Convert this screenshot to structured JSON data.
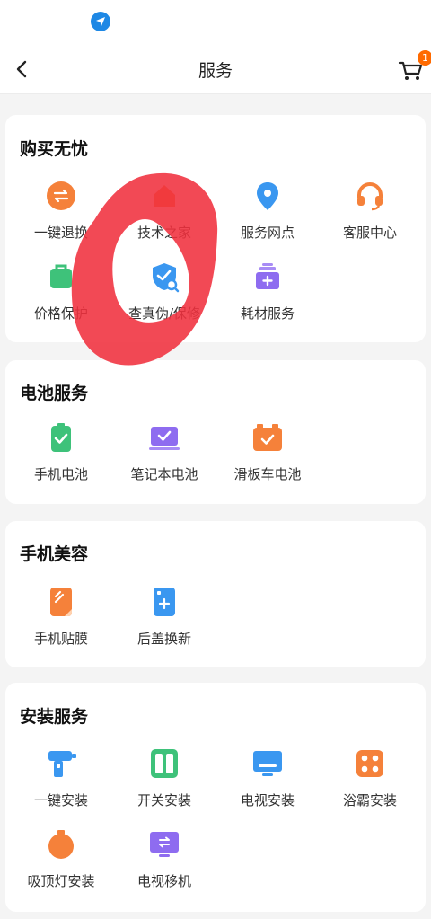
{
  "header": {
    "title": "服务",
    "cart_badge": "1"
  },
  "sections": [
    {
      "title": "购买无忧",
      "items": [
        {
          "label": "一键退换",
          "icon": "exchange-icon",
          "color": "#f5813a"
        },
        {
          "label": "技术之家",
          "icon": "tech-home-icon",
          "color": "#f5813a"
        },
        {
          "label": "服务网点",
          "icon": "location-pin-icon",
          "color": "#3a97f0"
        },
        {
          "label": "客服中心",
          "icon": "headset-icon",
          "color": "#f5813a"
        },
        {
          "label": "价格保护",
          "icon": "price-protect-icon",
          "color": "#3ec27a"
        },
        {
          "label": "查真伪/保修",
          "icon": "shield-search-icon",
          "color": "#3a97f0"
        },
        {
          "label": "耗材服务",
          "icon": "supplies-icon",
          "color": "#8e6cf0"
        }
      ]
    },
    {
      "title": "电池服务",
      "items": [
        {
          "label": "手机电池",
          "icon": "phone-battery-icon",
          "color": "#3ec27a"
        },
        {
          "label": "笔记本电池",
          "icon": "laptop-battery-icon",
          "color": "#8e6cf0"
        },
        {
          "label": "滑板车电池",
          "icon": "scooter-battery-icon",
          "color": "#f5813a"
        }
      ]
    },
    {
      "title": "手机美容",
      "items": [
        {
          "label": "手机贴膜",
          "icon": "screen-film-icon",
          "color": "#f5813a"
        },
        {
          "label": "后盖换新",
          "icon": "back-cover-icon",
          "color": "#3a97f0"
        }
      ]
    },
    {
      "title": "安装服务",
      "items": [
        {
          "label": "一键安装",
          "icon": "drill-icon",
          "color": "#3a97f0"
        },
        {
          "label": "开关安装",
          "icon": "switch-icon",
          "color": "#3ec27a"
        },
        {
          "label": "电视安装",
          "icon": "tv-icon",
          "color": "#3a97f0"
        },
        {
          "label": "浴霸安装",
          "icon": "bath-heater-icon",
          "color": "#f5813a"
        },
        {
          "label": "吸顶灯安装",
          "icon": "ceiling-lamp-icon",
          "color": "#f5813a"
        },
        {
          "label": "电视移机",
          "icon": "tv-move-icon",
          "color": "#8e6cf0"
        }
      ]
    }
  ]
}
